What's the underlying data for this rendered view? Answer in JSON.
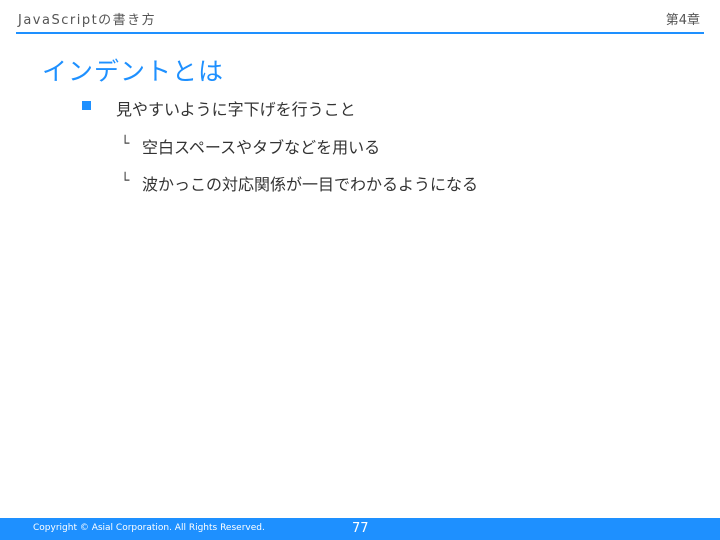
{
  "header": {
    "title": "JavaScriptの書き方",
    "chapter": "第4章"
  },
  "slide": {
    "title": "インデントとは",
    "bullet": "見やすいように字下げを行うこと",
    "sub_marker": "└",
    "sub_items": [
      "空白スペースやタブなどを用いる",
      "波かっこの対応関係が一目でわかるようになる"
    ]
  },
  "footer": {
    "copyright": "Copyright © Asial Corporation. All Rights Reserved.",
    "page": "77"
  },
  "colors": {
    "accent": "#1e90ff",
    "text": "#333333"
  }
}
